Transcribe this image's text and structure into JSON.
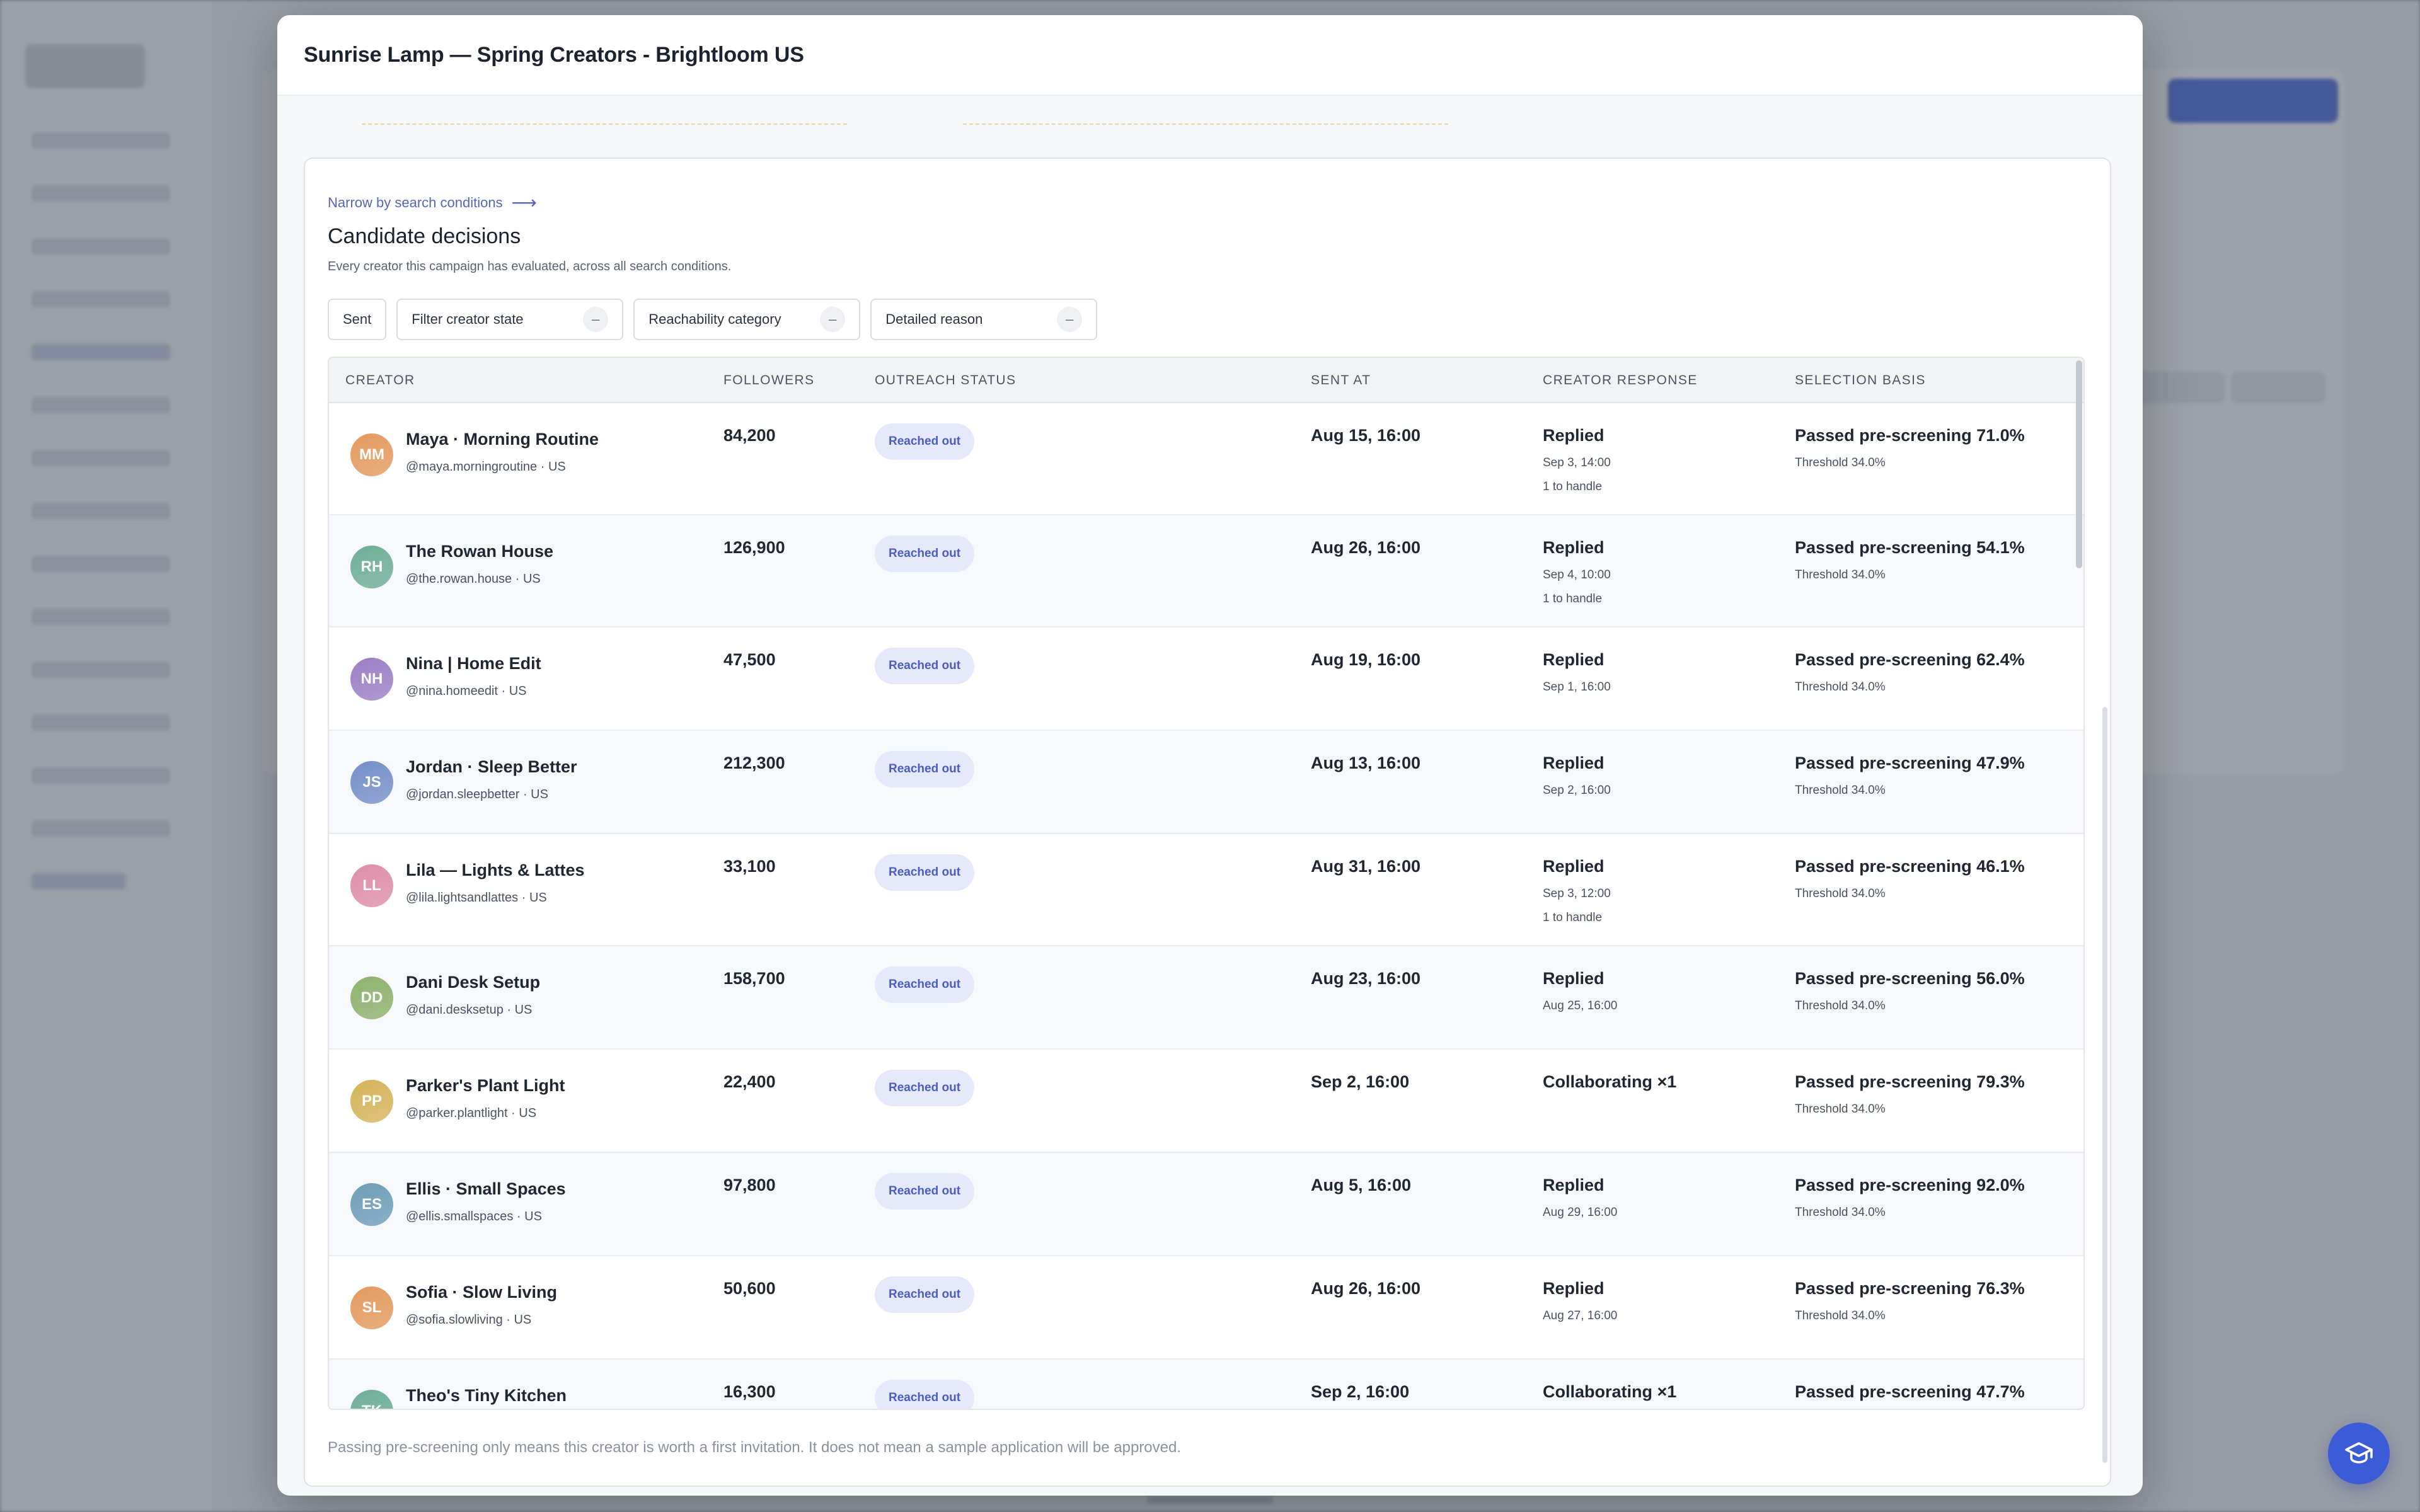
{
  "modal": {
    "title": "Sunrise Lamp — Spring Creators - Brightloom US"
  },
  "panel": {
    "crumb_label": "Narrow by search conditions",
    "title": "Candidate decisions",
    "subtitle": "Every creator this campaign has evaluated, across all search conditions."
  },
  "filters": {
    "sent_label": "Sent",
    "creator_state_label": "Filter creator state",
    "reachability_label": "Reachability category",
    "reason_label": "Detailed reason",
    "clear_symbol": "–"
  },
  "columns": {
    "creator": "Creator",
    "followers": "Followers",
    "outreach": "Outreach status",
    "sent_at": "Sent at",
    "response": "Creator response",
    "basis": "Selection basis"
  },
  "rows": [
    {
      "initials": "MM",
      "color": "#e39a5e",
      "name": "Maya · Morning Routine",
      "handle": "@maya.morningroutine · US",
      "followers": "84,200",
      "status": "Reached out",
      "sent": "Aug 15, 16:00",
      "response": "Replied",
      "response_date": "Sep 3, 14:00",
      "response_extra": "1 to handle",
      "basis": "Passed pre-screening 71.0%",
      "threshold": "Threshold 34.0%"
    },
    {
      "initials": "RH",
      "color": "#6fae97",
      "name": "The Rowan House",
      "handle": "@the.rowan.house · US",
      "followers": "126,900",
      "status": "Reached out",
      "sent": "Aug 26, 16:00",
      "response": "Replied",
      "response_date": "Sep 4, 10:00",
      "response_extra": "1 to handle",
      "basis": "Passed pre-screening 54.1%",
      "threshold": "Threshold 34.0%"
    },
    {
      "initials": "NH",
      "color": "#9c7fc4",
      "name": "Nina | Home Edit",
      "handle": "@nina.homeedit · US",
      "followers": "47,500",
      "status": "Reached out",
      "sent": "Aug 19, 16:00",
      "response": "Replied",
      "response_date": "Sep 1, 16:00",
      "response_extra": "",
      "basis": "Passed pre-screening 62.4%",
      "threshold": "Threshold 34.0%"
    },
    {
      "initials": "JS",
      "color": "#7590c9",
      "name": "Jordan · Sleep Better",
      "handle": "@jordan.sleepbetter · US",
      "followers": "212,300",
      "status": "Reached out",
      "sent": "Aug 13, 16:00",
      "response": "Replied",
      "response_date": "Sep 2, 16:00",
      "response_extra": "",
      "basis": "Passed pre-screening 47.9%",
      "threshold": "Threshold 34.0%"
    },
    {
      "initials": "LL",
      "color": "#de8ea8",
      "name": "Lila — Lights & Lattes",
      "handle": "@lila.lightsandlattes · US",
      "followers": "33,100",
      "status": "Reached out",
      "sent": "Aug 31, 16:00",
      "response": "Replied",
      "response_date": "Sep 3, 12:00",
      "response_extra": "1 to handle",
      "basis": "Passed pre-screening 46.1%",
      "threshold": "Threshold 34.0%"
    },
    {
      "initials": "DD",
      "color": "#8db36e",
      "name": "Dani Desk Setup",
      "handle": "@dani.desksetup · US",
      "followers": "158,700",
      "status": "Reached out",
      "sent": "Aug 23, 16:00",
      "response": "Replied",
      "response_date": "Aug 25, 16:00",
      "response_extra": "",
      "basis": "Passed pre-screening 56.0%",
      "threshold": "Threshold 34.0%"
    },
    {
      "initials": "PP",
      "color": "#d4b45a",
      "name": "Parker's Plant Light",
      "handle": "@parker.plantlight · US",
      "followers": "22,400",
      "status": "Reached out",
      "sent": "Sep 2, 16:00",
      "response": "Collaborating ×1",
      "response_date": "",
      "response_extra": "",
      "basis": "Passed pre-screening 79.3%",
      "threshold": "Threshold 34.0%"
    },
    {
      "initials": "ES",
      "color": "#6e9eb8",
      "name": "Ellis · Small Spaces",
      "handle": "@ellis.smallspaces · US",
      "followers": "97,800",
      "status": "Reached out",
      "sent": "Aug 5, 16:00",
      "response": "Replied",
      "response_date": "Aug 29, 16:00",
      "response_extra": "",
      "basis": "Passed pre-screening 92.0%",
      "threshold": "Threshold 34.0%"
    },
    {
      "initials": "SL",
      "color": "#e39a5e",
      "name": "Sofia · Slow Living",
      "handle": "@sofia.slowliving · US",
      "followers": "50,600",
      "status": "Reached out",
      "sent": "Aug 26, 16:00",
      "response": "Replied",
      "response_date": "Aug 27, 16:00",
      "response_extra": "",
      "basis": "Passed pre-screening 76.3%",
      "threshold": "Threshold 34.0%"
    },
    {
      "initials": "TK",
      "color": "#6fae97",
      "name": "Theo's Tiny Kitchen",
      "handle": "",
      "followers": "16,300",
      "status": "Reached out",
      "sent": "Sep 2, 16:00",
      "response": "Collaborating ×1",
      "response_date": "",
      "response_extra": "",
      "basis": "Passed pre-screening 47.7%",
      "threshold": ""
    }
  ],
  "footnote": "Passing pre-screening only means this creator is worth a first invitation. It does not mean a sample application will be approved.",
  "help_button": {
    "icon": "graduation-cap-icon"
  },
  "colors": {
    "accent": "#3c5bd6",
    "badge_bg": "#e6e9fb",
    "badge_text": "#4b5dc4"
  }
}
